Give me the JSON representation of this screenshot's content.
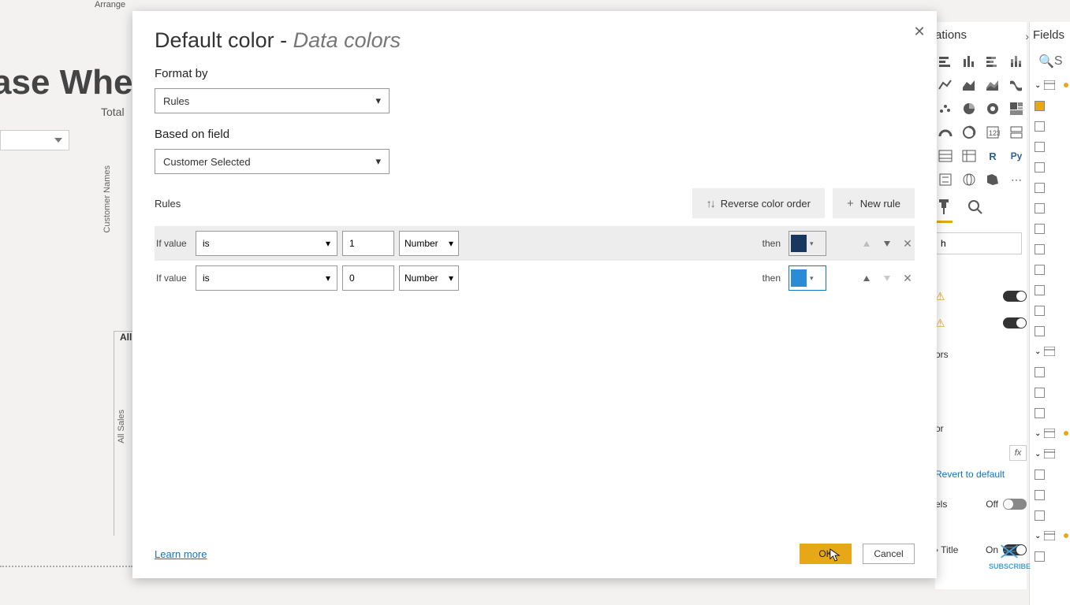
{
  "ribbon": {
    "arrange": "Arrange"
  },
  "background": {
    "title": "ase Wher",
    "total_label": "Total",
    "customer_names_axis": "Customer Names",
    "all_sales_axis": "All Sales",
    "all_label": "All"
  },
  "dialog": {
    "title_prefix": "Default color - ",
    "title_italic": "Data colors",
    "format_by_label": "Format by",
    "format_by_value": "Rules",
    "based_on_label": "Based on field",
    "based_on_value": "Customer Selected",
    "rules_label": "Rules",
    "reverse_btn": "Reverse color order",
    "new_rule_btn": "New rule",
    "rules": [
      {
        "if_label": "If value",
        "op": "is",
        "val": "1",
        "type": "Number",
        "then": "then",
        "color": "#18375f"
      },
      {
        "if_label": "If value",
        "op": "is",
        "val": "0",
        "type": "Number",
        "then": "then",
        "color": "#2b8bd6"
      }
    ],
    "learn_more": "Learn more",
    "ok": "OK",
    "cancel": "Cancel"
  },
  "viz_pane": {
    "title": "ations",
    "search_placeholder": "h"
  },
  "format": {
    "ors_label": "ors",
    "or_label": "or",
    "fx": "fx",
    "revert": "Revert to default",
    "els_label": "els",
    "els_state": "Off",
    "title_label": "Title",
    "title_state": "On"
  },
  "fields_pane": {
    "title": "Fields",
    "search": "S"
  },
  "subscribe": "SUBSCRIBE"
}
